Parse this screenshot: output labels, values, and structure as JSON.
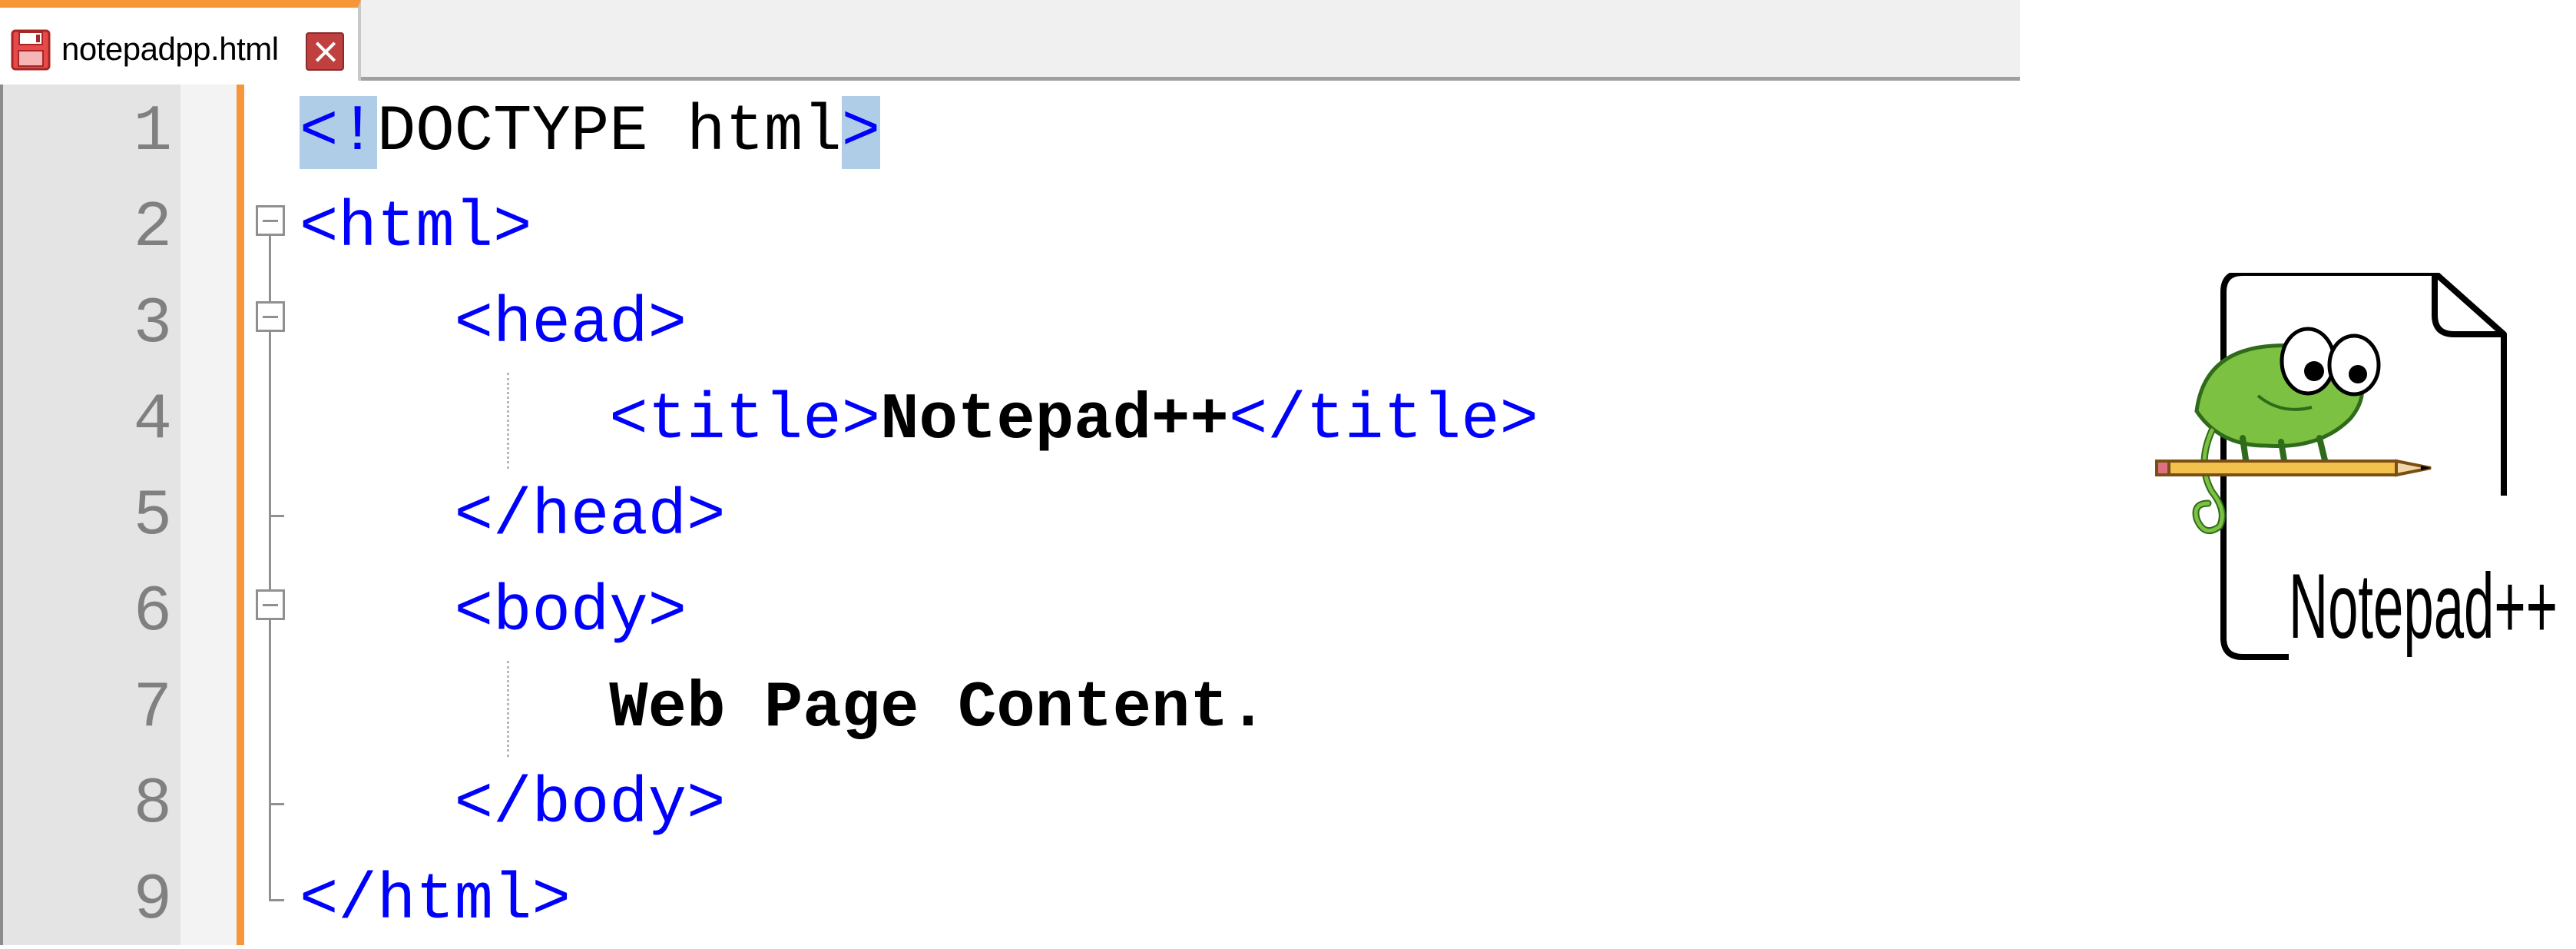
{
  "tab": {
    "filename": "notepadpp.html",
    "save_icon": "floppy-disk-icon",
    "close_icon": "close-icon",
    "accent_color": "#f79638"
  },
  "editor": {
    "line_numbers": [
      "1",
      "2",
      "3",
      "4",
      "5",
      "6",
      "7",
      "8",
      "9"
    ],
    "lines": {
      "l1": {
        "a": "<!",
        "b": "DOCTYPE html",
        "c": ">"
      },
      "l2": {
        "tag": "<html>"
      },
      "l3": {
        "indent": "    ",
        "tag": "<head>"
      },
      "l4": {
        "indent": "        ",
        "open": "<title>",
        "text": "Notepad++",
        "close": "</title>"
      },
      "l5": {
        "indent": "    ",
        "tag": "</head>"
      },
      "l6": {
        "indent": "    ",
        "tag": "<body>"
      },
      "l7": {
        "indent": "        ",
        "text": "Web Page Content."
      },
      "l8": {
        "indent": "    ",
        "tag": "</body>"
      },
      "l9": {
        "tag": "</html>"
      }
    },
    "colors": {
      "tag": "#0000ff",
      "text": "#000000",
      "line_number": "#808080",
      "match_highlight": "#b0cde8"
    }
  },
  "logo": {
    "text": "Notepad++",
    "icon": "chameleon-icon"
  }
}
